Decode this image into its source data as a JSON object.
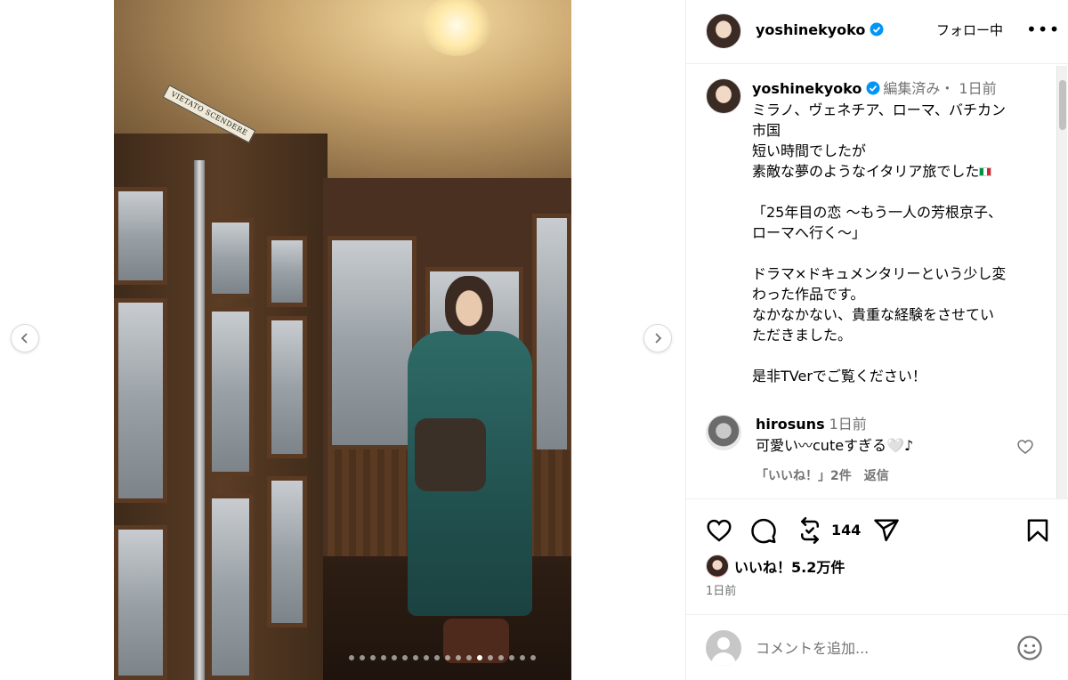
{
  "post": {
    "username": "yoshinekyoko",
    "follow_label": "フォロー中",
    "more_label": "•••",
    "photo_sign": "VIETATO SCENDERE",
    "carousel": {
      "count": 18,
      "active_index": 12
    }
  },
  "caption": {
    "username": "yoshinekyoko",
    "edited": "編集済み・ 1日前",
    "text": "ミラノ、ヴェネチア、ローマ、バチカン\n市国\n短い時間でしたが\n素敵な夢のようなイタリア旅でした",
    "text2": "\n\n「25年目の恋 〜もう一人の芳根京子、\nローマへ行く〜」\n\nドラマ×ドキュメンタリーという少し変\nわった作品です。\nなかなかない、貴重な経験をさせてい\nただきました。\n\n是非TVerでご覧ください！"
  },
  "comment": {
    "username": "hirosuns",
    "time": "1日前",
    "text": "可愛い〰cuteすぎる🤍♪",
    "likes_label": "「いいね！」2件",
    "reply_label": "返信"
  },
  "actions": {
    "repost_count": "144",
    "likes_text": "いいね！5.2万件",
    "post_time": "1日前"
  },
  "add_comment": {
    "placeholder": "コメントを追加..."
  },
  "icons": {
    "verified_color": "#0095f6",
    "heart": "heart-icon",
    "comment": "comment-icon",
    "repost": "repost-icon",
    "share": "share-icon",
    "save": "bookmark-icon",
    "emoji": "emoji-icon"
  }
}
